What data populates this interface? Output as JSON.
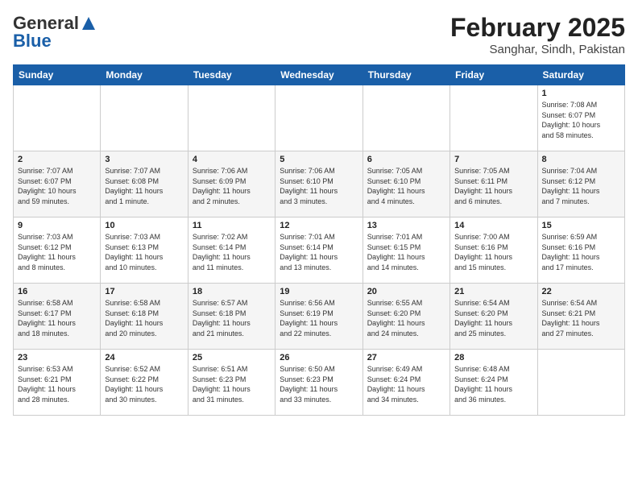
{
  "logo": {
    "line1": "General",
    "line2": "Blue"
  },
  "title": "February 2025",
  "subtitle": "Sanghar, Sindh, Pakistan",
  "days_of_week": [
    "Sunday",
    "Monday",
    "Tuesday",
    "Wednesday",
    "Thursday",
    "Friday",
    "Saturday"
  ],
  "weeks": [
    [
      {
        "day": "",
        "info": ""
      },
      {
        "day": "",
        "info": ""
      },
      {
        "day": "",
        "info": ""
      },
      {
        "day": "",
        "info": ""
      },
      {
        "day": "",
        "info": ""
      },
      {
        "day": "",
        "info": ""
      },
      {
        "day": "1",
        "info": "Sunrise: 7:08 AM\nSunset: 6:07 PM\nDaylight: 10 hours\nand 58 minutes."
      }
    ],
    [
      {
        "day": "2",
        "info": "Sunrise: 7:07 AM\nSunset: 6:07 PM\nDaylight: 10 hours\nand 59 minutes."
      },
      {
        "day": "3",
        "info": "Sunrise: 7:07 AM\nSunset: 6:08 PM\nDaylight: 11 hours\nand 1 minute."
      },
      {
        "day": "4",
        "info": "Sunrise: 7:06 AM\nSunset: 6:09 PM\nDaylight: 11 hours\nand 2 minutes."
      },
      {
        "day": "5",
        "info": "Sunrise: 7:06 AM\nSunset: 6:10 PM\nDaylight: 11 hours\nand 3 minutes."
      },
      {
        "day": "6",
        "info": "Sunrise: 7:05 AM\nSunset: 6:10 PM\nDaylight: 11 hours\nand 4 minutes."
      },
      {
        "day": "7",
        "info": "Sunrise: 7:05 AM\nSunset: 6:11 PM\nDaylight: 11 hours\nand 6 minutes."
      },
      {
        "day": "8",
        "info": "Sunrise: 7:04 AM\nSunset: 6:12 PM\nDaylight: 11 hours\nand 7 minutes."
      }
    ],
    [
      {
        "day": "9",
        "info": "Sunrise: 7:03 AM\nSunset: 6:12 PM\nDaylight: 11 hours\nand 8 minutes."
      },
      {
        "day": "10",
        "info": "Sunrise: 7:03 AM\nSunset: 6:13 PM\nDaylight: 11 hours\nand 10 minutes."
      },
      {
        "day": "11",
        "info": "Sunrise: 7:02 AM\nSunset: 6:14 PM\nDaylight: 11 hours\nand 11 minutes."
      },
      {
        "day": "12",
        "info": "Sunrise: 7:01 AM\nSunset: 6:14 PM\nDaylight: 11 hours\nand 13 minutes."
      },
      {
        "day": "13",
        "info": "Sunrise: 7:01 AM\nSunset: 6:15 PM\nDaylight: 11 hours\nand 14 minutes."
      },
      {
        "day": "14",
        "info": "Sunrise: 7:00 AM\nSunset: 6:16 PM\nDaylight: 11 hours\nand 15 minutes."
      },
      {
        "day": "15",
        "info": "Sunrise: 6:59 AM\nSunset: 6:16 PM\nDaylight: 11 hours\nand 17 minutes."
      }
    ],
    [
      {
        "day": "16",
        "info": "Sunrise: 6:58 AM\nSunset: 6:17 PM\nDaylight: 11 hours\nand 18 minutes."
      },
      {
        "day": "17",
        "info": "Sunrise: 6:58 AM\nSunset: 6:18 PM\nDaylight: 11 hours\nand 20 minutes."
      },
      {
        "day": "18",
        "info": "Sunrise: 6:57 AM\nSunset: 6:18 PM\nDaylight: 11 hours\nand 21 minutes."
      },
      {
        "day": "19",
        "info": "Sunrise: 6:56 AM\nSunset: 6:19 PM\nDaylight: 11 hours\nand 22 minutes."
      },
      {
        "day": "20",
        "info": "Sunrise: 6:55 AM\nSunset: 6:20 PM\nDaylight: 11 hours\nand 24 minutes."
      },
      {
        "day": "21",
        "info": "Sunrise: 6:54 AM\nSunset: 6:20 PM\nDaylight: 11 hours\nand 25 minutes."
      },
      {
        "day": "22",
        "info": "Sunrise: 6:54 AM\nSunset: 6:21 PM\nDaylight: 11 hours\nand 27 minutes."
      }
    ],
    [
      {
        "day": "23",
        "info": "Sunrise: 6:53 AM\nSunset: 6:21 PM\nDaylight: 11 hours\nand 28 minutes."
      },
      {
        "day": "24",
        "info": "Sunrise: 6:52 AM\nSunset: 6:22 PM\nDaylight: 11 hours\nand 30 minutes."
      },
      {
        "day": "25",
        "info": "Sunrise: 6:51 AM\nSunset: 6:23 PM\nDaylight: 11 hours\nand 31 minutes."
      },
      {
        "day": "26",
        "info": "Sunrise: 6:50 AM\nSunset: 6:23 PM\nDaylight: 11 hours\nand 33 minutes."
      },
      {
        "day": "27",
        "info": "Sunrise: 6:49 AM\nSunset: 6:24 PM\nDaylight: 11 hours\nand 34 minutes."
      },
      {
        "day": "28",
        "info": "Sunrise: 6:48 AM\nSunset: 6:24 PM\nDaylight: 11 hours\nand 36 minutes."
      },
      {
        "day": "",
        "info": ""
      }
    ]
  ]
}
